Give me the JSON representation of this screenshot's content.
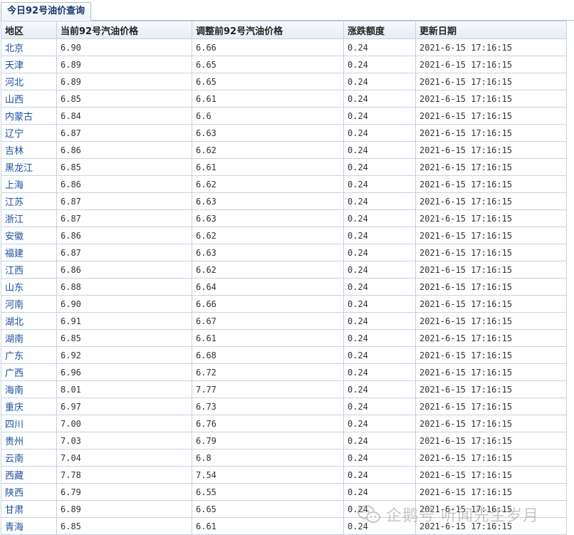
{
  "tab": {
    "label": "今日92号油价查询"
  },
  "table": {
    "columns": [
      "地区",
      "当前92号汽油价格",
      "调整前92号汽油价格",
      "涨跌额度",
      "更新日期"
    ],
    "rows": [
      [
        "北京",
        "6.90",
        "6.66",
        "0.24",
        "2021-6-15 17:16:15"
      ],
      [
        "天津",
        "6.89",
        "6.65",
        "0.24",
        "2021-6-15 17:16:15"
      ],
      [
        "河北",
        "6.89",
        "6.65",
        "0.24",
        "2021-6-15 17:16:15"
      ],
      [
        "山西",
        "6.85",
        "6.61",
        "0.24",
        "2021-6-15 17:16:15"
      ],
      [
        "内蒙古",
        "6.84",
        "6.6",
        "0.24",
        "2021-6-15 17:16:15"
      ],
      [
        "辽宁",
        "6.87",
        "6.63",
        "0.24",
        "2021-6-15 17:16:15"
      ],
      [
        "吉林",
        "6.86",
        "6.62",
        "0.24",
        "2021-6-15 17:16:15"
      ],
      [
        "黑龙江",
        "6.85",
        "6.61",
        "0.24",
        "2021-6-15 17:16:15"
      ],
      [
        "上海",
        "6.86",
        "6.62",
        "0.24",
        "2021-6-15 17:16:15"
      ],
      [
        "江苏",
        "6.87",
        "6.63",
        "0.24",
        "2021-6-15 17:16:15"
      ],
      [
        "浙江",
        "6.87",
        "6.63",
        "0.24",
        "2021-6-15 17:16:15"
      ],
      [
        "安徽",
        "6.86",
        "6.62",
        "0.24",
        "2021-6-15 17:16:15"
      ],
      [
        "福建",
        "6.87",
        "6.63",
        "0.24",
        "2021-6-15 17:16:15"
      ],
      [
        "江西",
        "6.86",
        "6.62",
        "0.24",
        "2021-6-15 17:16:15"
      ],
      [
        "山东",
        "6.88",
        "6.64",
        "0.24",
        "2021-6-15 17:16:15"
      ],
      [
        "河南",
        "6.90",
        "6.66",
        "0.24",
        "2021-6-15 17:16:15"
      ],
      [
        "湖北",
        "6.91",
        "6.67",
        "0.24",
        "2021-6-15 17:16:15"
      ],
      [
        "湖南",
        "6.85",
        "6.61",
        "0.24",
        "2021-6-15 17:16:15"
      ],
      [
        "广东",
        "6.92",
        "6.68",
        "0.24",
        "2021-6-15 17:16:15"
      ],
      [
        "广西",
        "6.96",
        "6.72",
        "0.24",
        "2021-6-15 17:16:15"
      ],
      [
        "海南",
        "8.01",
        "7.77",
        "0.24",
        "2021-6-15 17:16:15"
      ],
      [
        "重庆",
        "6.97",
        "6.73",
        "0.24",
        "2021-6-15 17:16:15"
      ],
      [
        "四川",
        "7.00",
        "6.76",
        "0.24",
        "2021-6-15 17:16:15"
      ],
      [
        "贵州",
        "7.03",
        "6.79",
        "0.24",
        "2021-6-15 17:16:15"
      ],
      [
        "云南",
        "7.04",
        "6.8",
        "0.24",
        "2021-6-15 17:16:15"
      ],
      [
        "西藏",
        "7.78",
        "7.54",
        "0.24",
        "2021-6-15 17:16:15"
      ],
      [
        "陕西",
        "6.79",
        "6.55",
        "0.24",
        "2021-6-15 17:16:15"
      ],
      [
        "甘肃",
        "6.89",
        "6.65",
        "0.24",
        "2021-6-15 17:16:15"
      ],
      [
        "青海",
        "6.85",
        "6.61",
        "0.24",
        "2021-6-15 17:16:15"
      ]
    ]
  },
  "watermark": {
    "icon": "wechat-logo-icon",
    "text": "企鹅号 听闻先生岁月"
  },
  "colors": {
    "region_link": "#1c4fa0",
    "border": "#c5d3e3",
    "tab_text": "#15366e"
  }
}
